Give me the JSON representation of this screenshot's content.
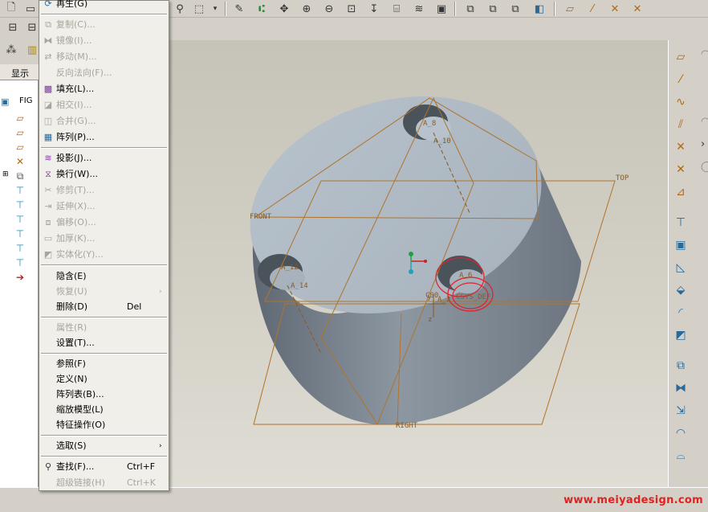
{
  "left_panel": {
    "tab_label": "显示",
    "tree_root": "FIG",
    "tree_items": [
      "datum-plane",
      "datum-plane",
      "datum-plane",
      "csys",
      "feature",
      "cut",
      "cut",
      "cut",
      "cut",
      "cut",
      "cut",
      "insert-here"
    ]
  },
  "context_menu": {
    "items": [
      {
        "label": "再生(G)",
        "enabled": true,
        "icon": "regenerate-icon"
      },
      {
        "label": "复制(C)...",
        "enabled": false,
        "icon": "copy-icon"
      },
      {
        "label": "镜像(I)...",
        "enabled": false,
        "icon": "mirror-icon"
      },
      {
        "label": "移动(M)...",
        "enabled": false,
        "icon": "move-icon"
      },
      {
        "label": "反向法向(F)...",
        "enabled": false,
        "icon": ""
      },
      {
        "label": "填充(L)...",
        "enabled": true,
        "icon": "fill-icon"
      },
      {
        "label": "相交(I)...",
        "enabled": false,
        "icon": "intersect-icon"
      },
      {
        "label": "合并(G)...",
        "enabled": false,
        "icon": "merge-icon"
      },
      {
        "label": "阵列(P)...",
        "enabled": true,
        "icon": "pattern-icon"
      },
      {
        "label": "投影(J)...",
        "enabled": true,
        "icon": "project-icon"
      },
      {
        "label": "换行(W)...",
        "enabled": true,
        "icon": "wrap-icon"
      },
      {
        "label": "修剪(T)...",
        "enabled": false,
        "icon": "trim-icon"
      },
      {
        "label": "延伸(X)...",
        "enabled": false,
        "icon": "extend-icon"
      },
      {
        "label": "偏移(O)...",
        "enabled": false,
        "icon": "offset-icon"
      },
      {
        "label": "加厚(K)...",
        "enabled": false,
        "icon": "thicken-icon"
      },
      {
        "label": "实体化(Y)...",
        "enabled": false,
        "icon": "solidify-icon"
      },
      {
        "label": "隐含(E)",
        "enabled": true,
        "icon": ""
      },
      {
        "label": "恢复(U)",
        "enabled": false,
        "icon": "",
        "submenu": true
      },
      {
        "label": "删除(D)",
        "enabled": true,
        "icon": "",
        "shortcut": "Del"
      },
      {
        "label": "属性(R)",
        "enabled": false,
        "icon": ""
      },
      {
        "label": "设置(T)...",
        "enabled": true,
        "icon": ""
      },
      {
        "label": "参照(F)",
        "enabled": true,
        "icon": ""
      },
      {
        "label": "定义(N)",
        "enabled": true,
        "icon": ""
      },
      {
        "label": "阵列表(B)...",
        "enabled": true,
        "icon": ""
      },
      {
        "label": "缩放模型(L)",
        "enabled": true,
        "icon": ""
      },
      {
        "label": "特征操作(O)",
        "enabled": true,
        "icon": ""
      },
      {
        "label": "选取(S)",
        "enabled": true,
        "icon": "",
        "submenu": true
      },
      {
        "label": "查找(F)...",
        "enabled": true,
        "icon": "find-icon",
        "shortcut": "Ctrl+F"
      },
      {
        "label": "超级链接(H)",
        "enabled": false,
        "icon": "",
        "shortcut": "Ctrl+K"
      }
    ]
  },
  "viewport": {
    "datum_labels": {
      "top": "TOP",
      "front": "FRONT",
      "right": "RIGHT"
    },
    "axis_labels": {
      "a8": "A_8",
      "a10": "A_10",
      "a12": "A_12",
      "a14": "A_14",
      "a6": "A_6",
      "a2": "A_2",
      "csys": "CS0",
      "csys_full": "CSYS_DEF",
      "y": "y",
      "z": "z"
    }
  },
  "statusbar": {
    "watermark": "www.meiyadesign.com"
  },
  "colors": {
    "menu_bg": "#f1efe9",
    "datum_orange": "#b0742a",
    "selection_red": "#e0202a",
    "model_grey": "#9aa4ae",
    "watermark_red": "#e2201e"
  }
}
